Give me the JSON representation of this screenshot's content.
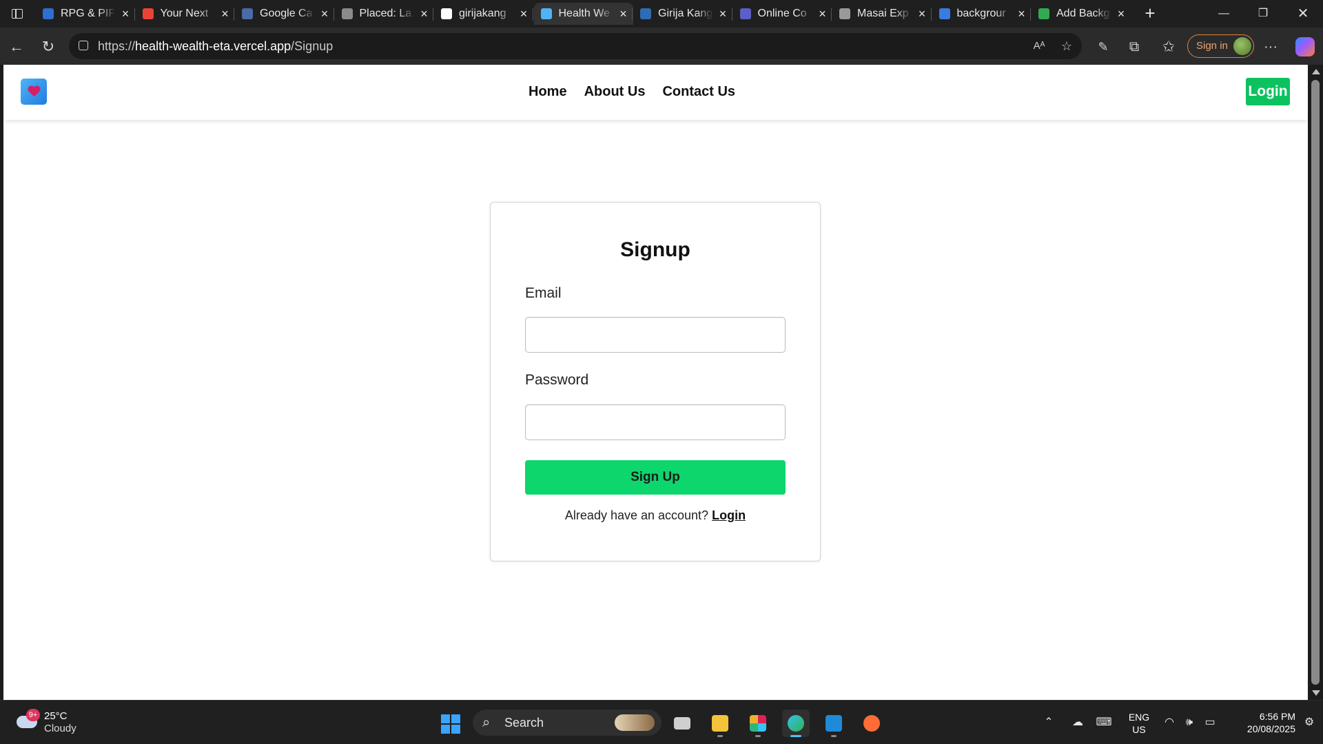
{
  "browser": {
    "tabs": [
      {
        "title": "RPG & PIF",
        "icon": "rpg-icon",
        "color": "#2f6fd1"
      },
      {
        "title": "Your Next",
        "icon": "gmail-icon",
        "color": "#ea4335"
      },
      {
        "title": "Google Ca",
        "icon": "google-calendar-icon",
        "color": "#4a6aa8"
      },
      {
        "title": "Placed: La",
        "icon": "placed-icon",
        "color": "#8a8a8a"
      },
      {
        "title": "girijakang",
        "icon": "github-icon",
        "color": "#ffffff"
      },
      {
        "title": "Health We",
        "icon": "health-wealth-icon",
        "color": "#4fb3f6"
      },
      {
        "title": "Girija Kang",
        "icon": "document-icon",
        "color": "#2c6db5"
      },
      {
        "title": "Online Co",
        "icon": "online-compiler-icon",
        "color": "#5b5fc7"
      },
      {
        "title": "Masai Exp",
        "icon": "masai-icon",
        "color": "#9a9a9a"
      },
      {
        "title": "backgrour",
        "icon": "search-icon",
        "color": "#3a7be0"
      },
      {
        "title": "Add Backg",
        "icon": "add-background-icon",
        "color": "#34a853"
      }
    ],
    "active_tab_index": 5,
    "address": {
      "scheme": "https://",
      "host": "health-wealth-eta.vercel.app",
      "path": "/Signup"
    },
    "signin_label": "Sign in"
  },
  "site": {
    "nav": {
      "links": [
        "Home",
        "About Us",
        "Contact Us"
      ],
      "login_label": "Login"
    },
    "signup": {
      "title": "Signup",
      "email_label": "Email",
      "email_value": "",
      "password_label": "Password",
      "password_value": "",
      "submit_label": "Sign Up",
      "switch_prompt": "Already have an account?",
      "switch_link": "Login"
    },
    "colors": {
      "accent": "#0dd66d",
      "login_button": "#0cc25f"
    }
  },
  "taskbar": {
    "weather": {
      "badge": "9+",
      "temperature": "25°C",
      "condition": "Cloudy"
    },
    "search_label": "Search",
    "lang": {
      "line1": "ENG",
      "line2": "US"
    },
    "time": "6:56 PM",
    "date": "20/08/2025"
  }
}
